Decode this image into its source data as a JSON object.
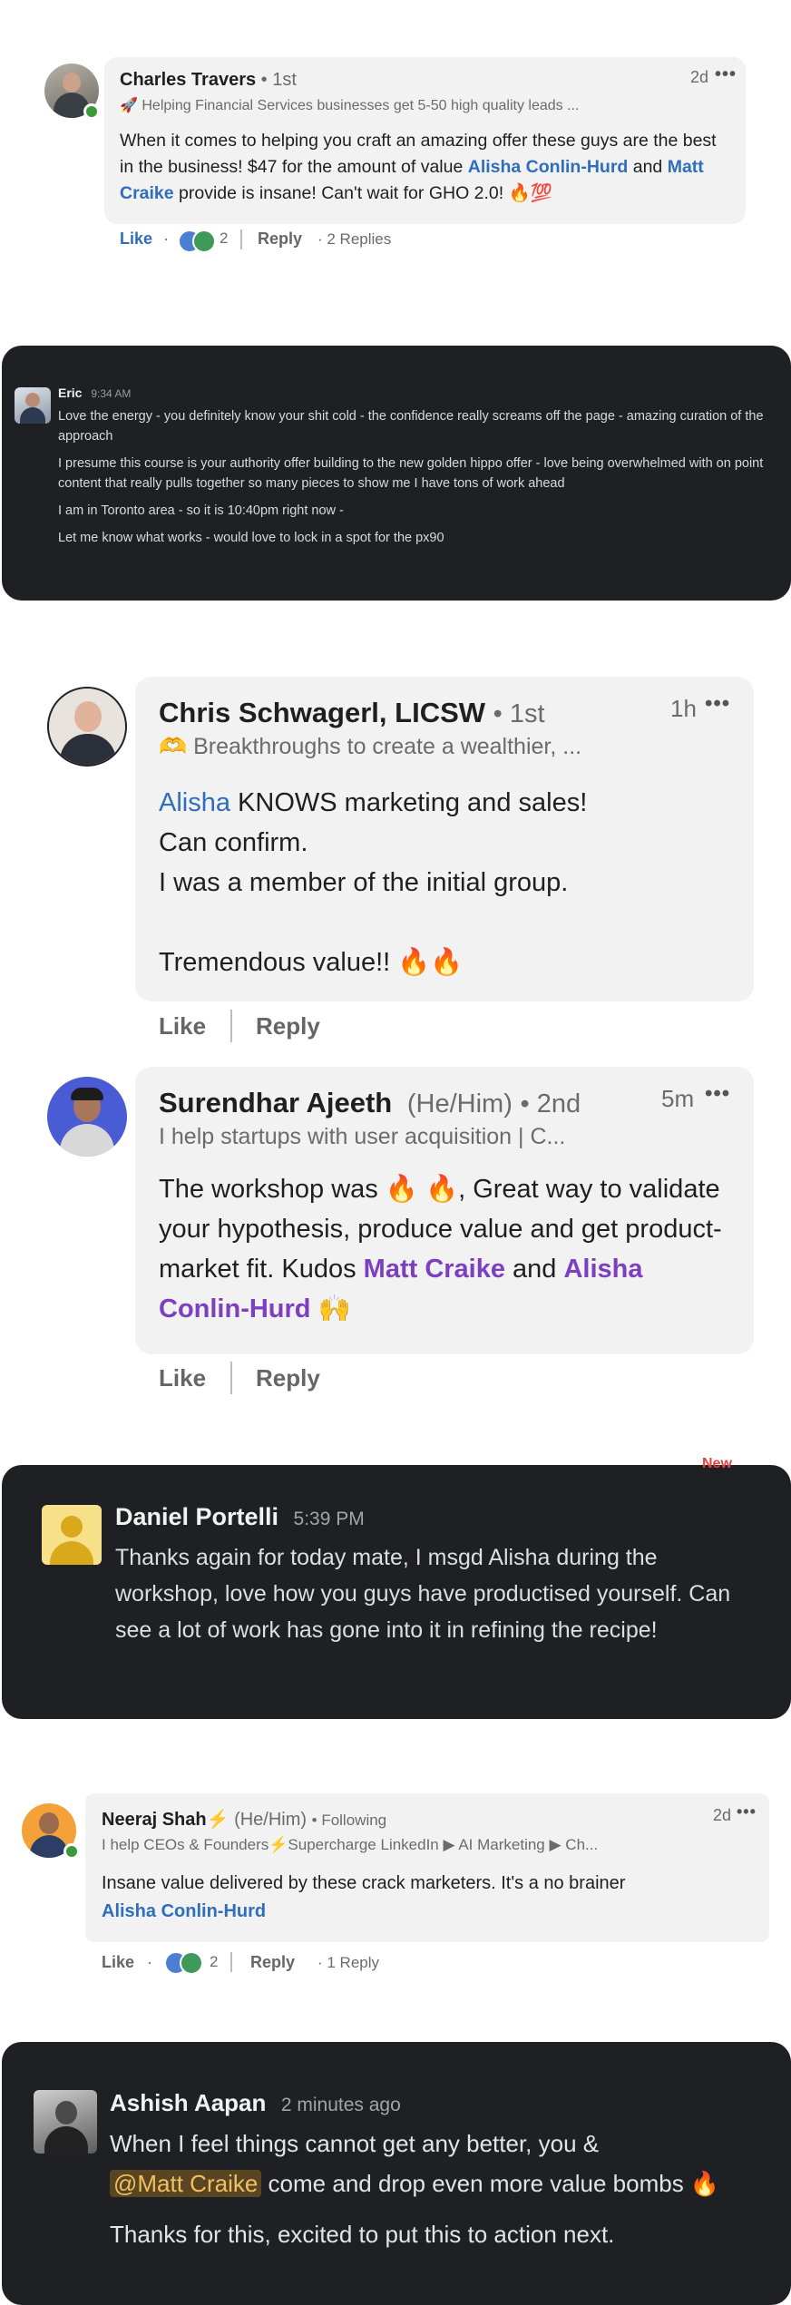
{
  "c1": {
    "name": "Charles Travers",
    "degree": "• 1st",
    "headline": "🚀 Helping Financial Services businesses get 5-50 high quality leads ...",
    "time": "2d",
    "text_a": "When it comes to helping you craft an amazing offer these guys are the best in the business! $47 for the amount of value ",
    "mention_1": "Alisha Conlin-Hurd",
    "text_b": " and ",
    "mention_2": "Matt Craike",
    "text_c": " provide is insane! Can't wait for GHO 2.0! 🔥💯",
    "like": "Like",
    "dot": "·",
    "reaction_count": "2",
    "reply": "Reply",
    "replies": "· 2 Replies"
  },
  "c2": {
    "name": "Eric",
    "time": "9:34 AM",
    "lines": [
      "Love the energy - you definitely know your shit cold - the confidence really screams off the page - amazing curation of the approach",
      "I presume this course is your authority offer building to the new golden hippo offer - love being overwhelmed with on point content that really pulls together so many pieces to show me I have tons of work ahead",
      "I am in Toronto area - so it is 10:40pm right now -",
      "Let me know what works - would love to lock in a spot for the px90"
    ]
  },
  "c3": {
    "name": "Chris Schwagerl, LICSW",
    "degree": "• 1st",
    "headline": "🫶 Breakthroughs to create a wealthier, ...",
    "time": "1h",
    "mention": "Alisha",
    "line1": " KNOWS marketing and sales!",
    "line2": "Can confirm.",
    "line3": "I was a member of the initial group.",
    "line4": "Tremendous value!! 🔥🔥",
    "like": "Like",
    "reply": "Reply"
  },
  "c4": {
    "name": "Surendhar Ajeeth",
    "pronouns": "(He/Him)",
    "degree": "• 2nd",
    "headline": "I help startups with user acquisition | C...",
    "time": "5m",
    "text_a": "The workshop was 🔥 🔥, Great way to validate your hypothesis, produce value and get product- market fit. Kudos ",
    "mention_1": "Matt Craike",
    "text_b": " and ",
    "mention_2": "Alisha Conlin-Hurd",
    "text_c": " 🙌",
    "like": "Like",
    "reply": "Reply"
  },
  "c5": {
    "name": "Daniel Portelli",
    "time": "5:39 PM",
    "badge": "New",
    "text": "Thanks again for today mate, I msgd Alisha during the workshop, love how you guys have productised yourself. Can see a lot of work has gone into it in refining the recipe!"
  },
  "c6": {
    "name": "Neeraj Shah",
    "bolt": "⚡",
    "pronouns": "(He/Him)",
    "degree": "• Following",
    "headline": "I help CEOs & Founders⚡Supercharge LinkedIn ▶ AI Marketing ▶ Ch...",
    "time": "2d",
    "text": "Insane value delivered by these crack marketers. It's a no brainer",
    "mention": "Alisha Conlin-Hurd",
    "like": "Like",
    "dot": "·",
    "reaction_count": "2",
    "reply": "Reply",
    "replies": "· 1 Reply"
  },
  "c7": {
    "name": "Ashish Aapan",
    "time": "2 minutes ago",
    "text_a": "When I feel things cannot get any better, you &",
    "mention": "@Matt Craike",
    "text_b": " come and drop even more value bombs 🔥",
    "text_c": "Thanks for this, excited to put this to action next."
  },
  "colors": {
    "dark_panel": "#1f2024",
    "bubble": "#f2f2f2",
    "mention_blue": "#2f6dbd",
    "mention_purple": "#7b3fc0",
    "online_green": "#3a9a3a"
  }
}
